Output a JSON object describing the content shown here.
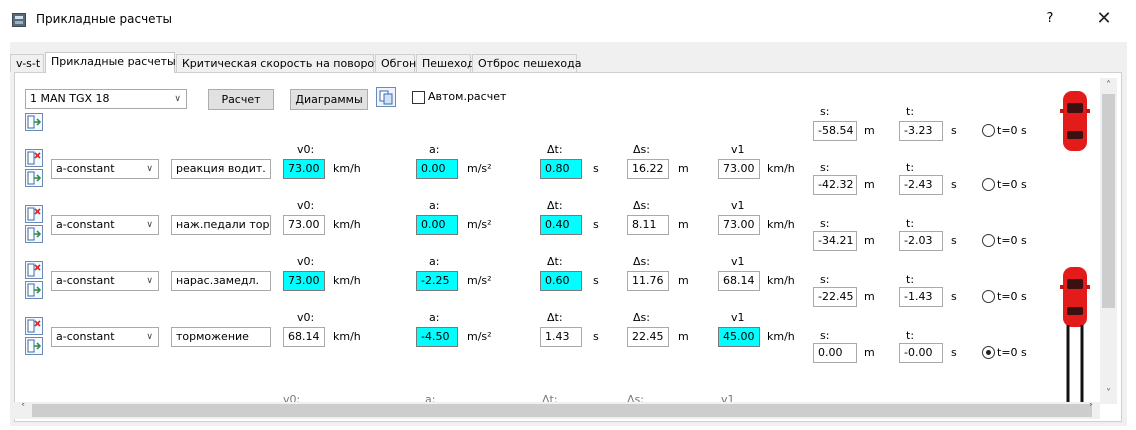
{
  "window": {
    "title": "Прикладные расчеты",
    "help": "?",
    "close": "✕"
  },
  "tabs": [
    {
      "label": "v-s-t",
      "active": false
    },
    {
      "label": "Прикладные расчеты",
      "active": true
    },
    {
      "label": "Критическая скорость на повороте",
      "active": false
    },
    {
      "label": "Обгон",
      "active": false
    },
    {
      "label": "Пешеход",
      "active": false
    },
    {
      "label": "Отброс пешехода",
      "active": false
    }
  ],
  "toolbar": {
    "vehicle": "1 MAN TGX 18",
    "calc_button": "Расчет",
    "diagrams_button": "Диаграммы",
    "auto_calc_label": "Автом.расчет",
    "auto_calc_checked": false
  },
  "labels": {
    "v0": "v0:",
    "a": "a:",
    "dt": "Δt:",
    "ds": "Δs:",
    "v1": "v1",
    "kmh": "km/h",
    "ms2": "m/s²",
    "s_unit": "s",
    "m_unit": "m",
    "s_label": "s:",
    "t_label": "t:",
    "t0": "t=0 s"
  },
  "header_result": {
    "s": "-58.54",
    "t": "-3.23",
    "t0_selected": false
  },
  "rows": [
    {
      "mode": "a-constant",
      "name": "реакция водит.",
      "v0": "73.00",
      "a": "0.00",
      "dt": "0.80",
      "ds": "16.22",
      "v1": "73.00",
      "v0_hl": true,
      "a_hl": true,
      "dt_hl": true,
      "ds_hl": false,
      "v1_hl": false,
      "res_s": "-42.32",
      "res_t": "-2.43",
      "t0_selected": false
    },
    {
      "mode": "a-constant",
      "name": "наж.педали торм",
      "v0": "73.00",
      "a": "0.00",
      "dt": "0.40",
      "ds": "8.11",
      "v1": "73.00",
      "v0_hl": false,
      "a_hl": true,
      "dt_hl": true,
      "ds_hl": false,
      "v1_hl": false,
      "res_s": "-34.21",
      "res_t": "-2.03",
      "t0_selected": false
    },
    {
      "mode": "a-constant",
      "name": "нарас.замедл.",
      "v0": "73.00",
      "a": "-2.25",
      "dt": "0.60",
      "ds": "11.76",
      "v1": "68.14",
      "v0_hl": true,
      "a_hl": true,
      "dt_hl": true,
      "ds_hl": false,
      "v1_hl": false,
      "res_s": "-22.45",
      "res_t": "-1.43",
      "t0_selected": false
    },
    {
      "mode": "a-constant",
      "name": "торможение",
      "v0": "68.14",
      "a": "-4.50",
      "dt": "1.43",
      "ds": "22.45",
      "v1": "45.00",
      "v0_hl": false,
      "a_hl": true,
      "dt_hl": false,
      "ds_hl": false,
      "v1_hl": true,
      "res_s": "0.00",
      "res_t": "-0.00",
      "t0_selected": true
    }
  ],
  "colors": {
    "highlight": "#00ffff",
    "car_red": "#e41b1b"
  }
}
